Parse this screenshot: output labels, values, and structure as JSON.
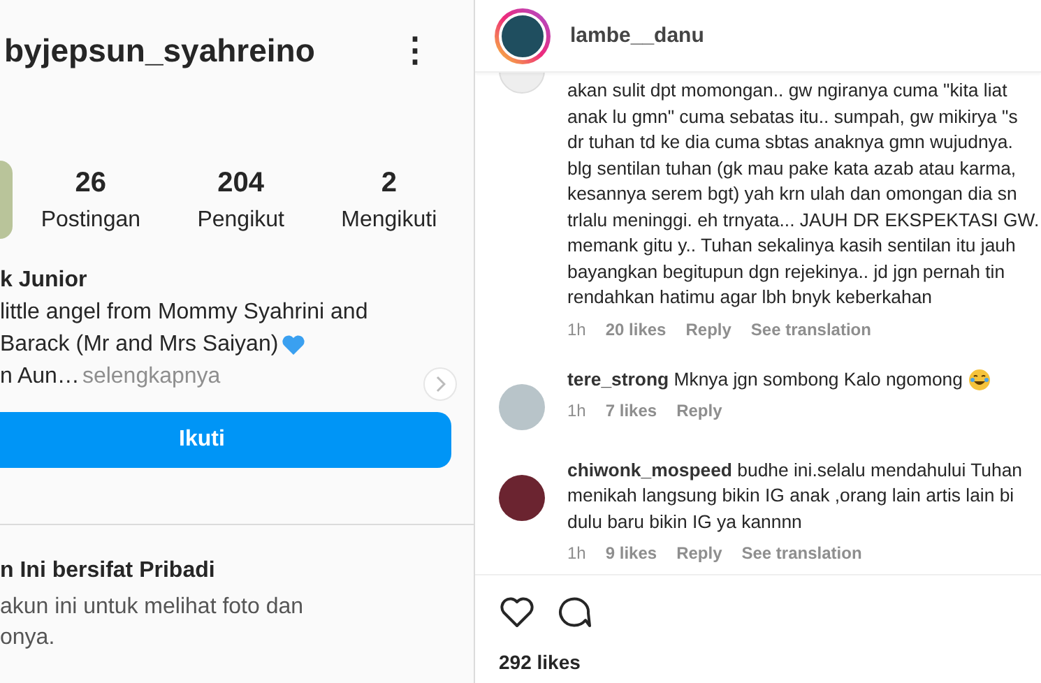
{
  "profile": {
    "username": "byjepsun_syahreino",
    "menu_glyph": "⋮",
    "stats": [
      {
        "value": "26",
        "label": "Postingan"
      },
      {
        "value": "204",
        "label": "Pengikut"
      },
      {
        "value": "2",
        "label": "Mengikuti"
      }
    ],
    "name": "k Junior",
    "bio_lines": [
      "little angel from Mommy Syahrini and",
      "Barack (Mr and Mrs Saiyan)"
    ],
    "bio_more": {
      "text": "n Aun…",
      "link": "selengkapnya"
    },
    "follow_button": "Ikuti",
    "private_title": "n Ini bersifat Pribadi",
    "private_lines": [
      "akun ini untuk melihat foto dan",
      "onya."
    ]
  },
  "post": {
    "author": "lambe__danu",
    "comments": [
      {
        "kind": "continued",
        "lines": [
          "akan sulit dpt momongan.. gw ngiranya cuma \"kita liat",
          "anak lu gmn\" cuma sebatas itu.. sumpah, gw mikirya \"s",
          "dr tuhan td ke dia cuma sbtas anaknya gmn wujudnya.",
          "blg sentilan tuhan (gk mau pake kata azab atau karma,",
          "kesannya serem bgt) yah krn ulah dan omongan dia sn",
          "trlalu meninggi. eh trnyata... JAUH DR EKSPEKTASI GW.",
          "memank gitu y.. Tuhan sekalinya kasih sentilan itu jauh",
          "bayangkan begitupun dgn rejekinya.. jd jgn pernah tin",
          "rendahkan hatimu agar lbh bnyk keberkahan"
        ],
        "time": "1h",
        "likes": "20 likes",
        "reply": "Reply",
        "translate": "See translation"
      },
      {
        "kind": "user",
        "user": "tere_strong",
        "lines": [
          "Mknya jgn sombong Kalo ngomong"
        ],
        "emoji": true,
        "time": "1h",
        "likes": "7 likes",
        "reply": "Reply"
      },
      {
        "kind": "user",
        "user": "chiwonk_mospeed",
        "lines": [
          "budhe ini.selalu mendahului Tuhan",
          "menikah langsung bikin IG anak ,orang lain artis lain bi",
          "dulu baru bikin IG ya kannnn"
        ],
        "time": "1h",
        "likes": "9 likes",
        "reply": "Reply",
        "translate": "See translation"
      }
    ],
    "likes": "292 likes"
  }
}
